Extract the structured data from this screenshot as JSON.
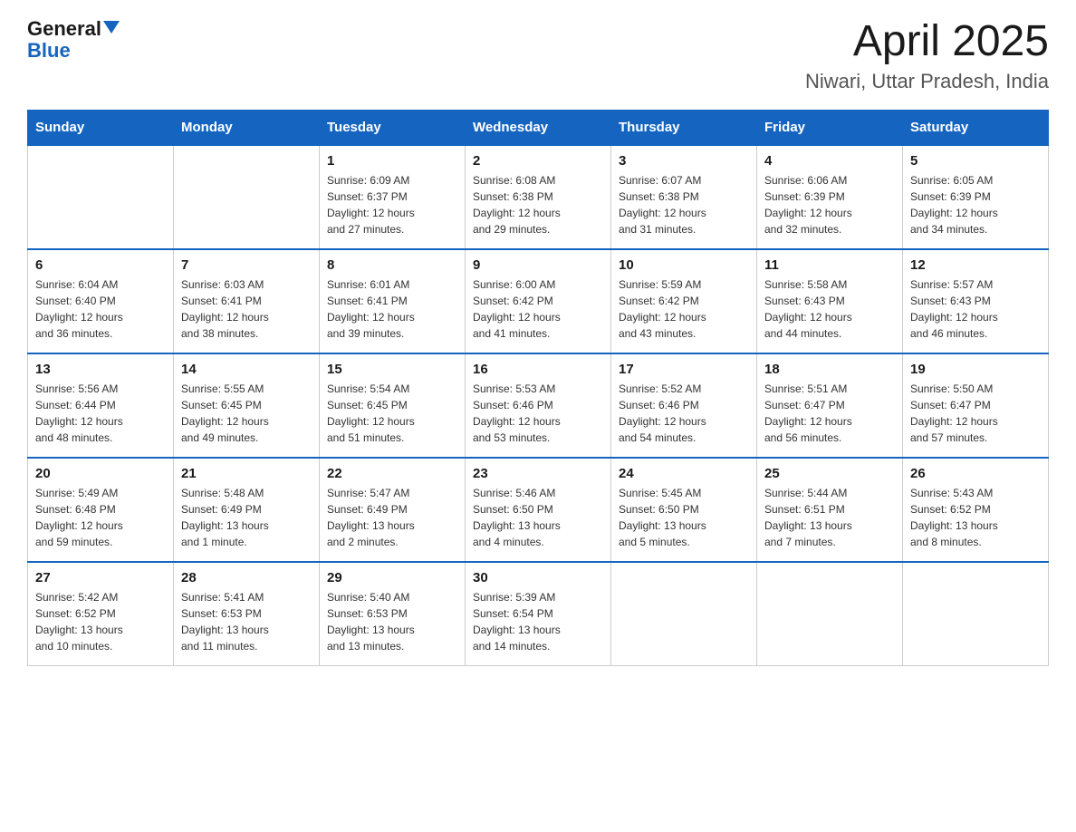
{
  "header": {
    "logo_general": "General",
    "logo_blue": "Blue",
    "title": "April 2025",
    "subtitle": "Niwari, Uttar Pradesh, India"
  },
  "days_of_week": [
    "Sunday",
    "Monday",
    "Tuesday",
    "Wednesday",
    "Thursday",
    "Friday",
    "Saturday"
  ],
  "weeks": [
    [
      {
        "day": "",
        "info": ""
      },
      {
        "day": "",
        "info": ""
      },
      {
        "day": "1",
        "info": "Sunrise: 6:09 AM\nSunset: 6:37 PM\nDaylight: 12 hours\nand 27 minutes."
      },
      {
        "day": "2",
        "info": "Sunrise: 6:08 AM\nSunset: 6:38 PM\nDaylight: 12 hours\nand 29 minutes."
      },
      {
        "day": "3",
        "info": "Sunrise: 6:07 AM\nSunset: 6:38 PM\nDaylight: 12 hours\nand 31 minutes."
      },
      {
        "day": "4",
        "info": "Sunrise: 6:06 AM\nSunset: 6:39 PM\nDaylight: 12 hours\nand 32 minutes."
      },
      {
        "day": "5",
        "info": "Sunrise: 6:05 AM\nSunset: 6:39 PM\nDaylight: 12 hours\nand 34 minutes."
      }
    ],
    [
      {
        "day": "6",
        "info": "Sunrise: 6:04 AM\nSunset: 6:40 PM\nDaylight: 12 hours\nand 36 minutes."
      },
      {
        "day": "7",
        "info": "Sunrise: 6:03 AM\nSunset: 6:41 PM\nDaylight: 12 hours\nand 38 minutes."
      },
      {
        "day": "8",
        "info": "Sunrise: 6:01 AM\nSunset: 6:41 PM\nDaylight: 12 hours\nand 39 minutes."
      },
      {
        "day": "9",
        "info": "Sunrise: 6:00 AM\nSunset: 6:42 PM\nDaylight: 12 hours\nand 41 minutes."
      },
      {
        "day": "10",
        "info": "Sunrise: 5:59 AM\nSunset: 6:42 PM\nDaylight: 12 hours\nand 43 minutes."
      },
      {
        "day": "11",
        "info": "Sunrise: 5:58 AM\nSunset: 6:43 PM\nDaylight: 12 hours\nand 44 minutes."
      },
      {
        "day": "12",
        "info": "Sunrise: 5:57 AM\nSunset: 6:43 PM\nDaylight: 12 hours\nand 46 minutes."
      }
    ],
    [
      {
        "day": "13",
        "info": "Sunrise: 5:56 AM\nSunset: 6:44 PM\nDaylight: 12 hours\nand 48 minutes."
      },
      {
        "day": "14",
        "info": "Sunrise: 5:55 AM\nSunset: 6:45 PM\nDaylight: 12 hours\nand 49 minutes."
      },
      {
        "day": "15",
        "info": "Sunrise: 5:54 AM\nSunset: 6:45 PM\nDaylight: 12 hours\nand 51 minutes."
      },
      {
        "day": "16",
        "info": "Sunrise: 5:53 AM\nSunset: 6:46 PM\nDaylight: 12 hours\nand 53 minutes."
      },
      {
        "day": "17",
        "info": "Sunrise: 5:52 AM\nSunset: 6:46 PM\nDaylight: 12 hours\nand 54 minutes."
      },
      {
        "day": "18",
        "info": "Sunrise: 5:51 AM\nSunset: 6:47 PM\nDaylight: 12 hours\nand 56 minutes."
      },
      {
        "day": "19",
        "info": "Sunrise: 5:50 AM\nSunset: 6:47 PM\nDaylight: 12 hours\nand 57 minutes."
      }
    ],
    [
      {
        "day": "20",
        "info": "Sunrise: 5:49 AM\nSunset: 6:48 PM\nDaylight: 12 hours\nand 59 minutes."
      },
      {
        "day": "21",
        "info": "Sunrise: 5:48 AM\nSunset: 6:49 PM\nDaylight: 13 hours\nand 1 minute."
      },
      {
        "day": "22",
        "info": "Sunrise: 5:47 AM\nSunset: 6:49 PM\nDaylight: 13 hours\nand 2 minutes."
      },
      {
        "day": "23",
        "info": "Sunrise: 5:46 AM\nSunset: 6:50 PM\nDaylight: 13 hours\nand 4 minutes."
      },
      {
        "day": "24",
        "info": "Sunrise: 5:45 AM\nSunset: 6:50 PM\nDaylight: 13 hours\nand 5 minutes."
      },
      {
        "day": "25",
        "info": "Sunrise: 5:44 AM\nSunset: 6:51 PM\nDaylight: 13 hours\nand 7 minutes."
      },
      {
        "day": "26",
        "info": "Sunrise: 5:43 AM\nSunset: 6:52 PM\nDaylight: 13 hours\nand 8 minutes."
      }
    ],
    [
      {
        "day": "27",
        "info": "Sunrise: 5:42 AM\nSunset: 6:52 PM\nDaylight: 13 hours\nand 10 minutes."
      },
      {
        "day": "28",
        "info": "Sunrise: 5:41 AM\nSunset: 6:53 PM\nDaylight: 13 hours\nand 11 minutes."
      },
      {
        "day": "29",
        "info": "Sunrise: 5:40 AM\nSunset: 6:53 PM\nDaylight: 13 hours\nand 13 minutes."
      },
      {
        "day": "30",
        "info": "Sunrise: 5:39 AM\nSunset: 6:54 PM\nDaylight: 13 hours\nand 14 minutes."
      },
      {
        "day": "",
        "info": ""
      },
      {
        "day": "",
        "info": ""
      },
      {
        "day": "",
        "info": ""
      }
    ]
  ]
}
